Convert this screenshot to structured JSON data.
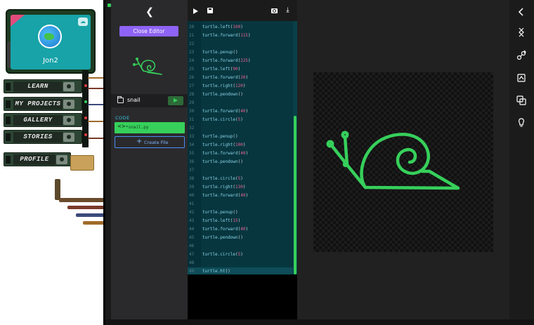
{
  "device": {
    "lcd_name": "Jon2",
    "badge": "☁",
    "nav_boards": [
      {
        "label": "LEARN"
      },
      {
        "label": "MY PROJECTS"
      },
      {
        "label": "GALLERY"
      },
      {
        "label": "STORIES"
      },
      {
        "label": "PROFILE"
      }
    ]
  },
  "sidebar": {
    "back_icon": "chevron-left-icon",
    "close_editor_label": "Close Editor",
    "project_name": "snail",
    "code_section_label": "CODE",
    "files": [
      {
        "name": "*snail.py",
        "glyph": "<>"
      }
    ],
    "create_file_label": "Create File",
    "create_file_plus": "+"
  },
  "editor": {
    "toolbar_icons": [
      "play-icon",
      "save-icon",
      "camera-icon",
      "download-icon"
    ],
    "lines": [
      {
        "n": "20",
        "code": "turtle.left(100)"
      },
      {
        "n": "21",
        "code": "turtle.forward(115)"
      },
      {
        "n": "22",
        "code": ""
      },
      {
        "n": "23",
        "code": "turtle.penup()"
      },
      {
        "n": "24",
        "code": "turtle.forward(225)"
      },
      {
        "n": "25",
        "code": "turtle.left(90)"
      },
      {
        "n": "26",
        "code": "turtle.forward(20)"
      },
      {
        "n": "27",
        "code": "turtle.right(120)"
      },
      {
        "n": "28",
        "code": "turtle.pendown()"
      },
      {
        "n": "29",
        "code": ""
      },
      {
        "n": "30",
        "code": "turtle.forward(40)"
      },
      {
        "n": "31",
        "code": "turtle.circle(5)"
      },
      {
        "n": "32",
        "code": ""
      },
      {
        "n": "33",
        "code": "turtle.penup()"
      },
      {
        "n": "34",
        "code": "turtle.right(100)"
      },
      {
        "n": "35",
        "code": "turtle.forward(40)"
      },
      {
        "n": "36",
        "code": "turtle.pendown()"
      },
      {
        "n": "37",
        "code": ""
      },
      {
        "n": "38",
        "code": "turtle.circle(5)"
      },
      {
        "n": "39",
        "code": "turtle.right(130)"
      },
      {
        "n": "40",
        "code": "turtle.forward(40)"
      },
      {
        "n": "41",
        "code": ""
      },
      {
        "n": "42",
        "code": "turtle.penup()"
      },
      {
        "n": "43",
        "code": "turtle.left(15)"
      },
      {
        "n": "44",
        "code": "turtle.forward(40)"
      },
      {
        "n": "45",
        "code": "turtle.pendown()"
      },
      {
        "n": "46",
        "code": ""
      },
      {
        "n": "47",
        "code": "turtle.circle(5)"
      },
      {
        "n": "48",
        "code": ""
      },
      {
        "n": "49",
        "code": "turtle.ht()"
      }
    ],
    "active_line": "49"
  },
  "canvas": {
    "drawing": "snail-drawing",
    "stroke_color": "#36d05b"
  },
  "right_toolbar": {
    "icons": [
      "chevron-left-icon",
      "remix-icon",
      "share-icon",
      "publish-icon",
      "duplicate-icon",
      "hint-icon"
    ]
  },
  "colors": {
    "accent_purple": "#8e63f5",
    "accent_green": "#36d05b",
    "accent_blue": "#4a8ef5",
    "code_bg": "#07363f"
  }
}
